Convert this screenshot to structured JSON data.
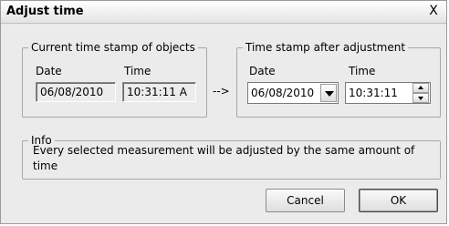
{
  "window": {
    "title": "Adjust time",
    "close_glyph": "X"
  },
  "current": {
    "legend": "Current time stamp of objects",
    "date_label": "Date",
    "time_label": "Time",
    "date_value": "06/08/2010",
    "time_value": "10:31:11 A"
  },
  "arrow": "-->",
  "adjusted": {
    "legend": "Time stamp after adjustment",
    "date_label": "Date",
    "time_label": "Time",
    "date_value": "06/08/2010",
    "time_value": "10:31:11"
  },
  "info": {
    "legend": "Info",
    "text": "Every selected measurement will be adjusted by the same amount of time"
  },
  "buttons": {
    "cancel": "Cancel",
    "ok": "OK"
  }
}
